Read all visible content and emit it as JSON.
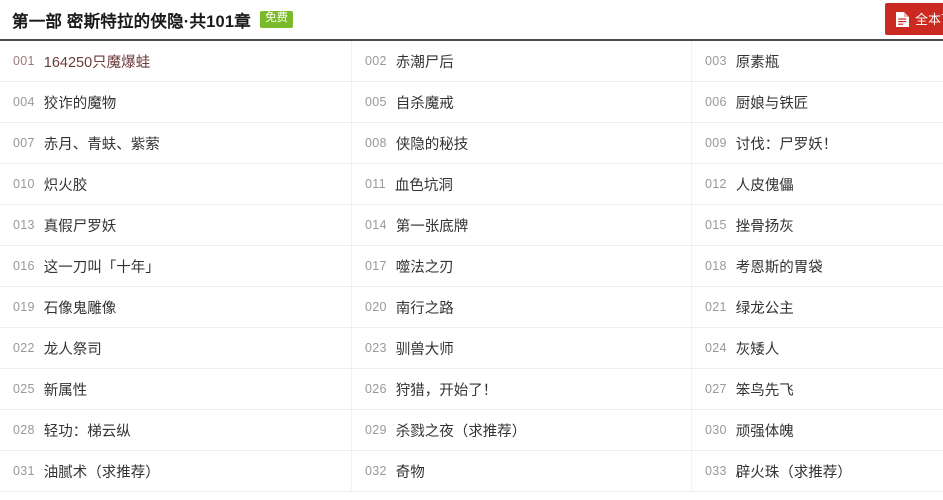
{
  "header": {
    "volume_title": "第一部 密斯特拉的侠隐·共101章",
    "free_badge": "免费",
    "download_button": {
      "label": "全本下载",
      "icon": "document-download-icon",
      "color": "#cc2a20"
    },
    "badge_color": "#7ab929"
  },
  "chapters": [
    {
      "index": "001",
      "title": "164250只魔爆蛙",
      "visited": true
    },
    {
      "index": "002",
      "title": "赤潮尸后",
      "visited": false
    },
    {
      "index": "003",
      "title": "原素瓶",
      "visited": false
    },
    {
      "index": "004",
      "title": "狡诈的魔物",
      "visited": false
    },
    {
      "index": "005",
      "title": "自杀魔戒",
      "visited": false
    },
    {
      "index": "006",
      "title": "厨娘与铁匠",
      "visited": false
    },
    {
      "index": "007",
      "title": "赤月、青蚨、紫萦",
      "visited": false
    },
    {
      "index": "008",
      "title": "侠隐的秘技",
      "visited": false
    },
    {
      "index": "009",
      "title": "讨伐：尸罗妖！",
      "visited": false
    },
    {
      "index": "010",
      "title": "炽火胶",
      "visited": false
    },
    {
      "index": "011",
      "title": "血色坑洞",
      "visited": false
    },
    {
      "index": "012",
      "title": "人皮傀儡",
      "visited": false
    },
    {
      "index": "013",
      "title": "真假尸罗妖",
      "visited": false
    },
    {
      "index": "014",
      "title": "第一张底牌",
      "visited": false
    },
    {
      "index": "015",
      "title": "挫骨扬灰",
      "visited": false
    },
    {
      "index": "016",
      "title": "这一刀叫「十年」",
      "visited": false
    },
    {
      "index": "017",
      "title": "噬法之刃",
      "visited": false
    },
    {
      "index": "018",
      "title": "考恩斯的胃袋",
      "visited": false
    },
    {
      "index": "019",
      "title": "石像鬼雕像",
      "visited": false
    },
    {
      "index": "020",
      "title": "南行之路",
      "visited": false
    },
    {
      "index": "021",
      "title": "绿龙公主",
      "visited": false
    },
    {
      "index": "022",
      "title": "龙人祭司",
      "visited": false
    },
    {
      "index": "023",
      "title": "驯兽大师",
      "visited": false
    },
    {
      "index": "024",
      "title": "灰矮人",
      "visited": false
    },
    {
      "index": "025",
      "title": "新属性",
      "visited": false
    },
    {
      "index": "026",
      "title": "狩猎，开始了！",
      "visited": false
    },
    {
      "index": "027",
      "title": "笨鸟先飞",
      "visited": false
    },
    {
      "index": "028",
      "title": "轻功：梯云纵",
      "visited": false
    },
    {
      "index": "029",
      "title": "杀戮之夜（求推荐）",
      "visited": false
    },
    {
      "index": "030",
      "title": "顽强体魄",
      "visited": false
    },
    {
      "index": "031",
      "title": "油腻术（求推荐）",
      "visited": false
    },
    {
      "index": "032",
      "title": "奇物",
      "visited": false
    },
    {
      "index": "033",
      "title": "辟火珠（求推荐）",
      "visited": false
    }
  ],
  "layout": {
    "columns": 3
  }
}
